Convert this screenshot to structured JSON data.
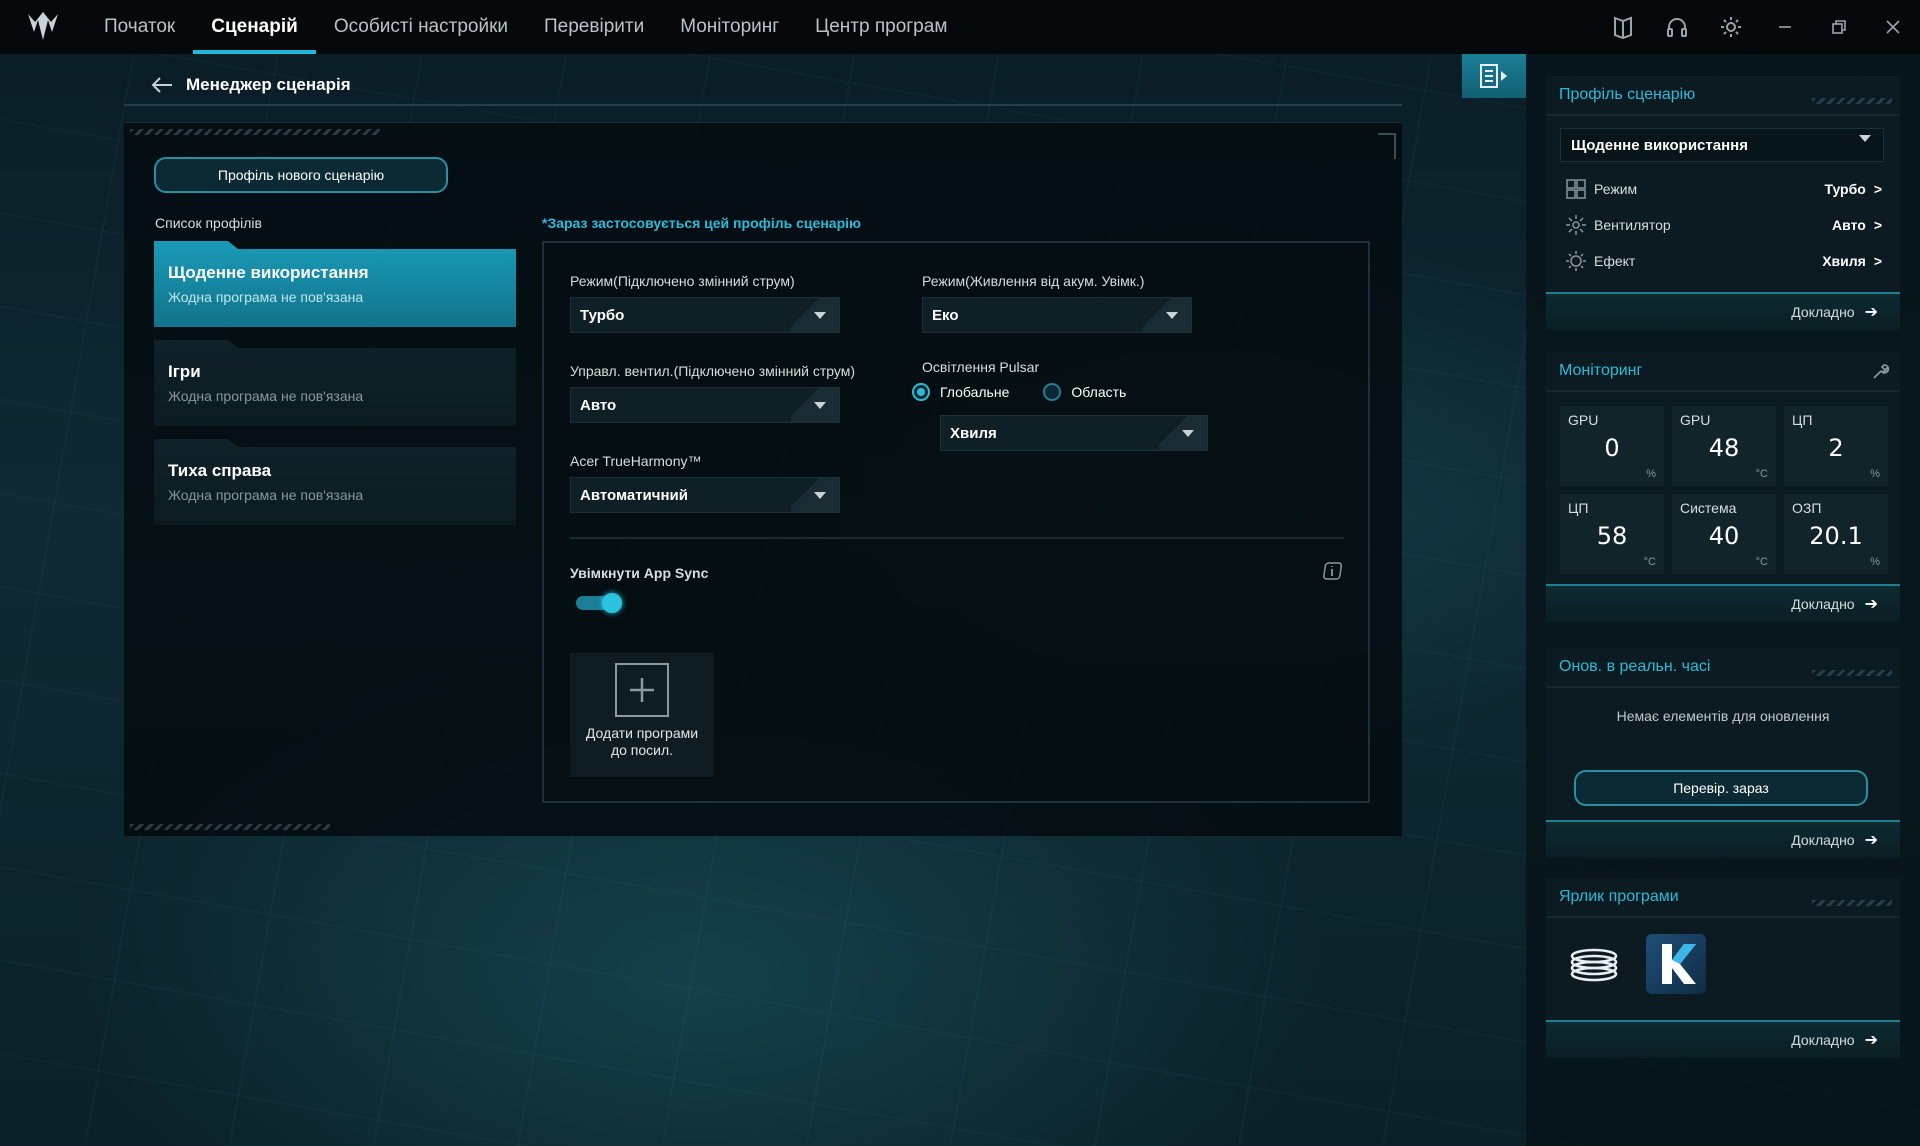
{
  "nav": {
    "items": [
      {
        "label": "Початок",
        "active": false
      },
      {
        "label": "Сценарій",
        "active": true
      },
      {
        "label": "Особисті настройки",
        "active": false
      },
      {
        "label": "Перевірити",
        "active": false
      },
      {
        "label": "Моніторинг",
        "active": false
      },
      {
        "label": "Центр програм",
        "active": false
      }
    ],
    "icons": [
      "book-icon",
      "headset-icon",
      "gear-icon",
      "minimize-icon",
      "restore-icon",
      "close-icon"
    ]
  },
  "breadcrumb": {
    "title": "Менеджер сценарія"
  },
  "profiles": {
    "new_button": "Профіль нового сценарію",
    "list_label": "Список профілів",
    "items": [
      {
        "name": "Щоденне використання",
        "sub": "Жодна програма не пов'язана",
        "active": true
      },
      {
        "name": "Ігри",
        "sub": "Жодна програма не пов'язана",
        "active": false
      },
      {
        "name": "Тиха справа",
        "sub": "Жодна програма не пов'язана",
        "active": false
      }
    ]
  },
  "settings": {
    "notice": "*Зараз застосовується цей профіль сценарію",
    "mode_ac_label": "Режим(Підключено змінний струм)",
    "mode_ac_value": "Турбо",
    "mode_battery_label": "Режим(Живлення від акум. Увімк.)",
    "mode_battery_value": "Еко",
    "fan_ac_label": "Управл. вентил.(Підключено змінний струм)",
    "fan_ac_value": "Авто",
    "pulsar_label": "Освітлення Pulsar",
    "pulsar_global": "Глобальне",
    "pulsar_area": "Область",
    "pulsar_value": "Хвиля",
    "trueharmony_label": "Acer TrueHarmony™",
    "trueharmony_value": "Автоматичний",
    "appsync_label": "Увімкнути App Sync",
    "appsync_on": true,
    "add_apps_line1": "Додати програми",
    "add_apps_line2": "до посил."
  },
  "sidebar": {
    "profile_card": {
      "title": "Профіль сценарію",
      "selected": "Щоденне використання",
      "rows": [
        {
          "label": "Режим",
          "value": "Турбо",
          "icon": "grid-icon"
        },
        {
          "label": "Вентилятор",
          "value": "Авто",
          "icon": "fan-icon"
        },
        {
          "label": "Ефект",
          "value": "Хвиля",
          "icon": "sun-icon"
        }
      ],
      "more": "Докладно"
    },
    "monitor_card": {
      "title": "Моніторинг",
      "cells": [
        {
          "label": "GPU",
          "value": "0",
          "unit": "%"
        },
        {
          "label": "GPU",
          "value": "48",
          "unit": "°C"
        },
        {
          "label": "ЦП",
          "value": "2",
          "unit": "%"
        },
        {
          "label": "ЦП",
          "value": "58",
          "unit": "°C"
        },
        {
          "label": "Система",
          "value": "40",
          "unit": "°C"
        },
        {
          "label": "ОЗП",
          "value": "20.1",
          "unit": "%"
        }
      ],
      "more": "Докладно"
    },
    "update_card": {
      "title": "Онов. в реальн. часі",
      "empty": "Немає елементів для оновлення",
      "button": "Перевір. зараз",
      "more": "Докладно"
    },
    "shortcut_card": {
      "title": "Ярлик програми",
      "apps": [
        "disc-stack-app-icon",
        "k-app-icon"
      ],
      "more": "Докладно"
    }
  },
  "colors": {
    "accent": "#2bbbd8",
    "active_card": "#1a9bb8",
    "topbar": "#05090c"
  }
}
